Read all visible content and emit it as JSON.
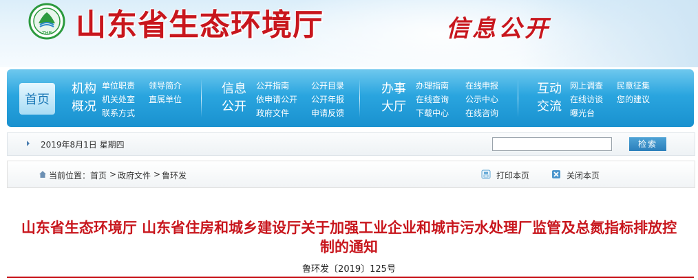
{
  "header": {
    "site_title": "山东省生态环境厅",
    "section_title": "信息公开",
    "logo_text": "ZHB"
  },
  "nav": {
    "home": "首页",
    "groups": [
      {
        "title_line1": "机构",
        "title_line2": "概况",
        "links": [
          "单位职责",
          "机关处室",
          "联系方式",
          "领导简介",
          "直属单位"
        ]
      },
      {
        "title_line1": "信息",
        "title_line2": "公开",
        "links": [
          "公开指南",
          "依申请公开",
          "政府文件",
          "公开目录",
          "公开年报",
          "申请反馈"
        ]
      },
      {
        "title_line1": "办事",
        "title_line2": "大厅",
        "links": [
          "办理指南",
          "在线查询",
          "下载中心",
          "在线申报",
          "公示中心",
          "在线咨询"
        ]
      },
      {
        "title_line1": "互动",
        "title_line2": "交流",
        "links": [
          "网上调查",
          "在线访谈",
          "曝光台",
          "民意征集",
          "您的建议"
        ]
      }
    ]
  },
  "datebar": {
    "date": "2019年8月1日 星期四",
    "search_value": "",
    "search_button": "检索"
  },
  "location": {
    "label": "当前位置：",
    "crumbs": [
      "首页",
      "政府文件",
      "鲁环发"
    ],
    "separator": ">",
    "print": "打印本页",
    "close": "关闭本页"
  },
  "article": {
    "title_line1": "山东省生态环境厅 山东省住房和城乡建设厅关于加强工业企业和城市污水处理厂监管及总氮指标排放控",
    "title_line2": "制的通知",
    "doc_number": "鲁环发〔2019〕125号"
  },
  "colors": {
    "accent_red": "#c8161d",
    "nav_blue": "#1991cf"
  }
}
